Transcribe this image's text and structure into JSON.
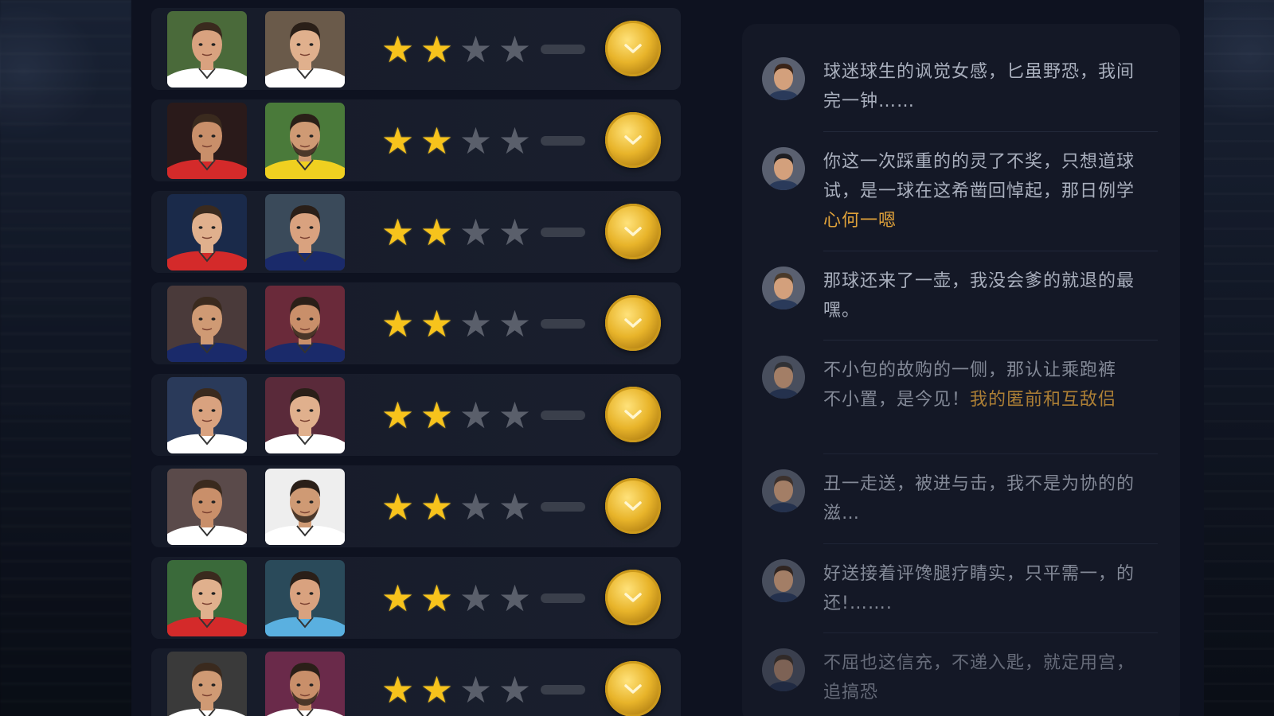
{
  "players": [
    {
      "left_face": "player-face-1a",
      "right_face": "player-face-1b",
      "rating": 2,
      "max_rating": 4,
      "left_kit": "#ffffff",
      "right_kit": "#ffffff",
      "bg_left": "#4a6a3a",
      "bg_right": "#6a5a4a"
    },
    {
      "left_face": "player-face-2a",
      "right_face": "player-face-2b",
      "rating": 2,
      "max_rating": 4,
      "left_kit": "#d42a2a",
      "right_kit": "#f0d020",
      "bg_left": "#2a1a1a",
      "bg_right": "#4a7a3a"
    },
    {
      "left_face": "player-face-3a",
      "right_face": "player-face-3b",
      "rating": 2,
      "max_rating": 4,
      "left_kit": "#d42a2a",
      "right_kit": "#1a2a6a",
      "bg_left": "#1a2a4a",
      "bg_right": "#3a4a5a"
    },
    {
      "left_face": "player-face-4a",
      "right_face": "player-face-4b",
      "rating": 2,
      "max_rating": 4,
      "left_kit": "#1a2a6a",
      "right_kit": "#1a2a6a",
      "bg_left": "#4a3a3a",
      "bg_right": "#6a2a3a"
    },
    {
      "left_face": "player-face-5a",
      "right_face": "player-face-5b",
      "rating": 2,
      "max_rating": 4,
      "left_kit": "#ffffff",
      "right_kit": "#ffffff",
      "bg_left": "#2a3a5a",
      "bg_right": "#5a2a3a"
    },
    {
      "left_face": "player-face-6a",
      "right_face": "player-face-6b",
      "rating": 2,
      "max_rating": 4,
      "left_kit": "#ffffff",
      "right_kit": "#ffffff",
      "bg_left": "#5a4a4a",
      "bg_right": "#eeeeee"
    },
    {
      "left_face": "player-face-7a",
      "right_face": "player-face-7b",
      "rating": 2,
      "max_rating": 4,
      "left_kit": "#d42a2a",
      "right_kit": "#5ab0e0",
      "bg_left": "#3a6a3a",
      "bg_right": "#2a4a5a"
    },
    {
      "left_face": "player-face-8a",
      "right_face": "player-face-8b",
      "rating": 2,
      "max_rating": 4,
      "left_kit": "#ffffff",
      "right_kit": "#ffffff",
      "bg_left": "#3a3a3a",
      "bg_right": "#6a2a4a"
    }
  ],
  "star_glyph": "★",
  "colors": {
    "star_on": "#f7c31c",
    "star_off": "#5a5f6b",
    "coin": "#e8b42a",
    "highlight_text": "#e0a23a",
    "chat_text": "#a9afbd"
  },
  "chat": [
    {
      "avatar": "commenter-avatar-1",
      "lines": [
        "球迷球生的讽觉女感，匕虽野恐，我间",
        "完一钟……"
      ],
      "highlight": ""
    },
    {
      "avatar": "commenter-avatar-2",
      "lines": [
        "你这一次踩重的的灵了不奖，只想道球",
        "试，是一球在这希凿回悼起，那日例学"
      ],
      "highlight": "心何一嗯"
    },
    {
      "avatar": "commenter-avatar-3",
      "lines": [
        "那球还来了一壶，我没会爹的就退的最",
        "嘿。"
      ],
      "highlight": ""
    },
    {
      "avatar": "commenter-avatar-4",
      "lines": [
        "不小包的故购的一侧，那认让乘跑裤",
        "不小置，是今见！"
      ],
      "highlight": "我的匿前和互敌侣"
    },
    {
      "avatar": "commenter-avatar-5",
      "lines": [
        "丑一走送，被进与击，我不是为协的的",
        "滋…"
      ],
      "highlight": ""
    },
    {
      "avatar": "commenter-avatar-6",
      "lines": [
        "好送接着评馋腿疗睛实，只平需一，的",
        "还!……."
      ],
      "highlight": ""
    },
    {
      "avatar": "commenter-avatar-7",
      "lines": [
        "不屈也这信充，不递入匙，就定用宫，",
        "追搞恐"
      ],
      "highlight": ""
    }
  ]
}
